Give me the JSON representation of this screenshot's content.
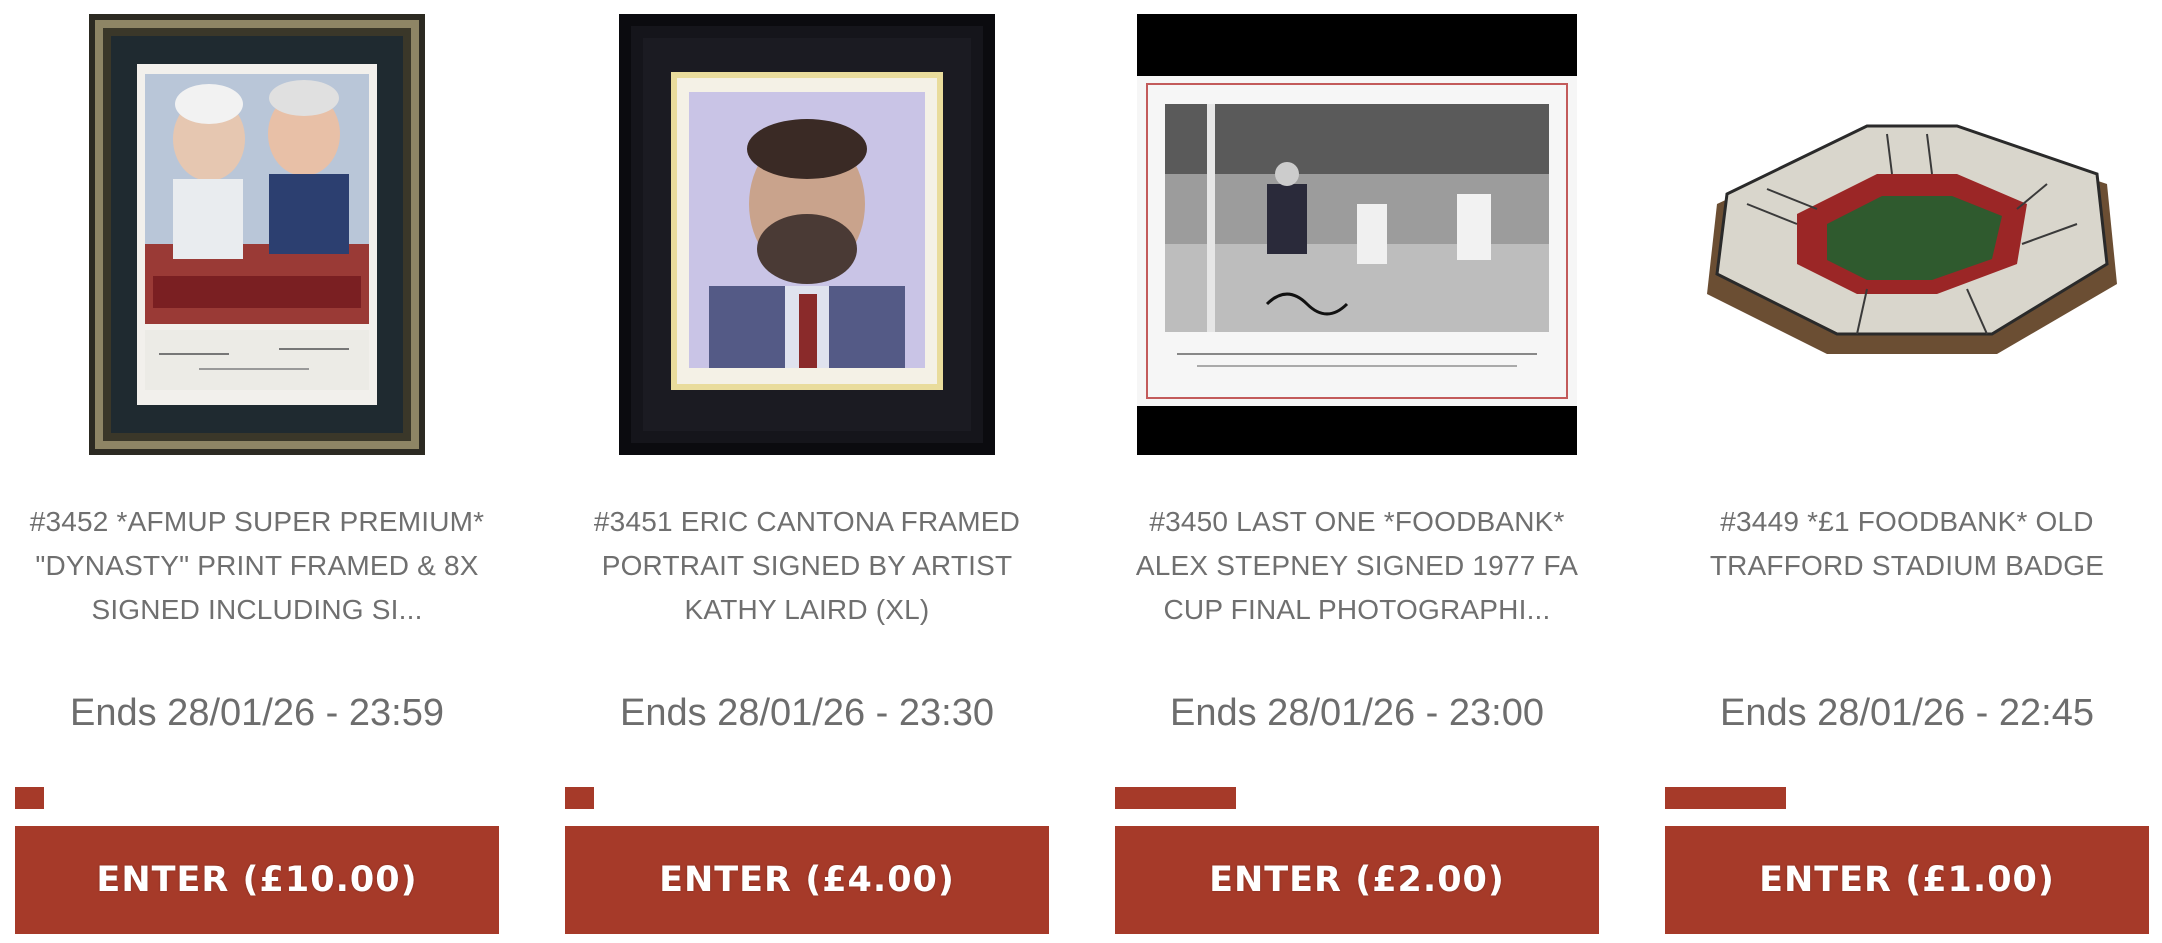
{
  "colors": {
    "accent": "#a63a29",
    "text": "#6f6f6f",
    "background": "#ffffff"
  },
  "products": [
    {
      "title": "#3452 *AFMUP SUPER PREMIUM* \"DYNASTY\" PRINT FRAMED & 8X SIGNED INCLUDING SI...",
      "ends": "Ends 28/01/26 - 23:59",
      "enter_label": "ENTER (£10.00)",
      "progress_fraction": 0.06,
      "image": "framed-dynasty-print"
    },
    {
      "title": "#3451 ERIC CANTONA FRAMED PORTRAIT SIGNED BY ARTIST KATHY LAIRD (XL)",
      "ends": "Ends 28/01/26 - 23:30",
      "enter_label": "ENTER (£4.00)",
      "progress_fraction": 0.06,
      "image": "framed-cantona-portrait"
    },
    {
      "title": "#3450 LAST ONE *FOODBANK* ALEX STEPNEY SIGNED 1977 FA CUP FINAL PHOTOGRAPHI...",
      "ends": "Ends 28/01/26 - 23:00",
      "enter_label": "ENTER (£2.00)",
      "progress_fraction": 0.25,
      "image": "signed-fa-cup-photo"
    },
    {
      "title": "#3449 *£1 FOODBANK* OLD TRAFFORD STADIUM BADGE",
      "ends": "Ends 28/01/26 - 22:45",
      "enter_label": "ENTER (£1.00)",
      "progress_fraction": 0.25,
      "image": "stadium-pin-badge"
    }
  ]
}
